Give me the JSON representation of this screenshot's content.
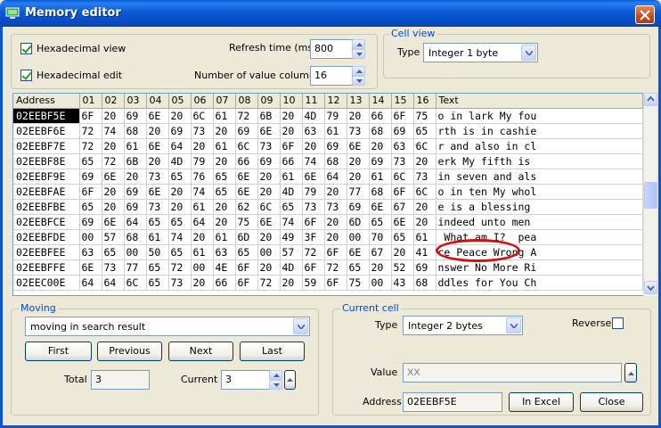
{
  "window": {
    "title": "Memory editor"
  },
  "settings": {
    "hex_view_label": "Hexadecimal view",
    "hex_edit_label": "Hexadecimal edit",
    "refresh_label": "Refresh time (ms)",
    "refresh_value": "800",
    "columns_label": "Number of value columns",
    "columns_value": "16"
  },
  "cell_view": {
    "title": "Cell view",
    "type_label": "Type",
    "type_value": "Integer 1 byte"
  },
  "grid": {
    "headers": [
      "Address",
      "01",
      "02",
      "03",
      "04",
      "05",
      "06",
      "07",
      "08",
      "09",
      "10",
      "11",
      "12",
      "13",
      "14",
      "15",
      "16",
      "Text"
    ],
    "rows": [
      {
        "addr": "02EEBF5E",
        "bytes": [
          "6F",
          "20",
          "69",
          "6E",
          "20",
          "6C",
          "61",
          "72",
          "6B",
          "20",
          "4D",
          "79",
          "20",
          "66",
          "6F",
          "75"
        ],
        "text": "o in lark My fou"
      },
      {
        "addr": "02EEBF6E",
        "bytes": [
          "72",
          "74",
          "68",
          "20",
          "69",
          "73",
          "20",
          "69",
          "6E",
          "20",
          "63",
          "61",
          "73",
          "68",
          "69",
          "65"
        ],
        "text": "rth is in cashie"
      },
      {
        "addr": "02EEBF7E",
        "bytes": [
          "72",
          "20",
          "61",
          "6E",
          "64",
          "20",
          "61",
          "6C",
          "73",
          "6F",
          "20",
          "69",
          "6E",
          "20",
          "63",
          "6C"
        ],
        "text": "r and also in cl"
      },
      {
        "addr": "02EEBF8E",
        "bytes": [
          "65",
          "72",
          "6B",
          "20",
          "4D",
          "79",
          "20",
          "66",
          "69",
          "66",
          "74",
          "68",
          "20",
          "69",
          "73",
          "20"
        ],
        "text": "erk My fifth is"
      },
      {
        "addr": "02EEBF9E",
        "bytes": [
          "69",
          "6E",
          "20",
          "73",
          "65",
          "76",
          "65",
          "6E",
          "20",
          "61",
          "6E",
          "64",
          "20",
          "61",
          "6C",
          "73"
        ],
        "text": "in seven and als"
      },
      {
        "addr": "02EEBFAE",
        "bytes": [
          "6F",
          "20",
          "69",
          "6E",
          "20",
          "74",
          "65",
          "6E",
          "20",
          "4D",
          "79",
          "20",
          "77",
          "68",
          "6F",
          "6C"
        ],
        "text": "o in ten My whol"
      },
      {
        "addr": "02EEBFBE",
        "bytes": [
          "65",
          "20",
          "69",
          "73",
          "20",
          "61",
          "20",
          "62",
          "6C",
          "65",
          "73",
          "73",
          "69",
          "6E",
          "67",
          "20"
        ],
        "text": "e is a blessing"
      },
      {
        "addr": "02EEBFCE",
        "bytes": [
          "69",
          "6E",
          "64",
          "65",
          "65",
          "64",
          "20",
          "75",
          "6E",
          "74",
          "6F",
          "20",
          "6D",
          "65",
          "6E",
          "20"
        ],
        "text": "indeed unto men"
      },
      {
        "addr": "02EEBFDE",
        "bytes": [
          "00",
          "57",
          "68",
          "61",
          "74",
          "20",
          "61",
          "6D",
          "20",
          "49",
          "3F",
          "20",
          "00",
          "70",
          "65",
          "61"
        ],
        "text": " What am I?  pea"
      },
      {
        "addr": "02EEBFEE",
        "bytes": [
          "63",
          "65",
          "00",
          "50",
          "65",
          "61",
          "63",
          "65",
          "00",
          "57",
          "72",
          "6F",
          "6E",
          "67",
          "20",
          "41"
        ],
        "text": "ce Peace Wrong A"
      },
      {
        "addr": "02EEBFFE",
        "bytes": [
          "6E",
          "73",
          "77",
          "65",
          "72",
          "00",
          "4E",
          "6F",
          "20",
          "4D",
          "6F",
          "72",
          "65",
          "20",
          "52",
          "69"
        ],
        "text": "nswer No More Ri"
      },
      {
        "addr": "02EEC00E",
        "bytes": [
          "64",
          "64",
          "6C",
          "65",
          "73",
          "20",
          "66",
          "6F",
          "72",
          "20",
          "59",
          "6F",
          "75",
          "00",
          "43",
          "68"
        ],
        "text": "ddles for You Ch"
      }
    ],
    "selected_address": "02EEBF5E"
  },
  "moving": {
    "title": "Moving",
    "mode_value": "moving in search result",
    "first_label": "First",
    "previous_label": "Previous",
    "next_label": "Next",
    "last_label": "Last",
    "total_label": "Total",
    "total_value": "3",
    "current_label": "Current",
    "current_value": "3"
  },
  "current_cell": {
    "title": "Current cell",
    "type_label": "Type",
    "type_value": "Integer 2 bytes",
    "reverse_label": "Reverse",
    "value_label": "Value",
    "value_placeholder": "XX",
    "address_label": "Address",
    "address_value": "02EEBF5E",
    "in_excel_label": "In Excel",
    "close_label": "Close"
  },
  "colors": {
    "title_bar": "#0a5fd8",
    "group_title": "#0046d5",
    "highlight_oval": "#d11010"
  },
  "icons": [
    "app-icon",
    "close-icon",
    "checkmark-icon",
    "spin-up-icon",
    "spin-down-icon",
    "dropdown-arrow-icon"
  ]
}
